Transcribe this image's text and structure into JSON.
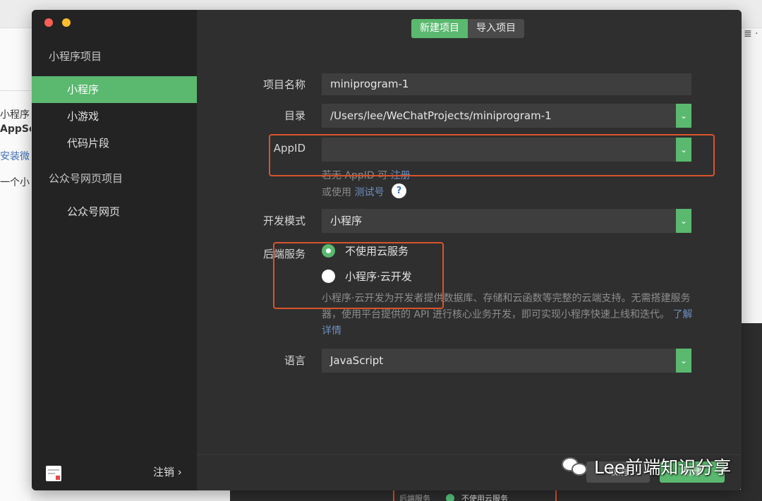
{
  "background": {
    "side_text_1": "小程序",
    "side_text_2": "AppSe",
    "side_text_3": "安装微",
    "side_text_4": "一个小",
    "bottom_text_1": "后端服务",
    "bottom_text_2": "不使用云服务"
  },
  "window": {
    "tabs": [
      {
        "label": "新建项目",
        "active": true
      },
      {
        "label": "导入项目",
        "active": false
      }
    ]
  },
  "sidebar": {
    "section_1": "小程序项目",
    "items_1": [
      "小程序",
      "小游戏",
      "代码片段"
    ],
    "section_2": "公众号网页项目",
    "items_2": [
      "公众号网页"
    ],
    "logout": "注销",
    "logout_chevron": "›"
  },
  "form": {
    "name_label": "项目名称",
    "name_value": "miniprogram-1",
    "dir_label": "目录",
    "dir_value": "/Users/lee/WeChatProjects/miniprogram-1",
    "appid_label": "AppID",
    "appid_value": "",
    "appid_hint_1": "若无 AppID 可",
    "appid_hint_register": "注册",
    "appid_hint_2": "或使用",
    "appid_hint_test": "测试号",
    "help_icon": "?",
    "mode_label": "开发模式",
    "mode_value": "小程序",
    "backend_label": "后端服务",
    "backend_option_1": "不使用云服务",
    "backend_option_2": "小程序·云开发",
    "backend_desc": "小程序·云开发为开发者提供数据库、存储和云函数等完整的云端支持。无需搭建服务器，使用平台提供的 API 进行核心业务开发，即可实现小程序快速上线和迭代。",
    "backend_learn_more": "了解详情",
    "lang_label": "语言",
    "lang_value": "JavaScript",
    "chevron": "⌄"
  },
  "footer": {
    "cancel": "取消",
    "create": "新建"
  },
  "watermark": "Lee前端知识分享",
  "colors": {
    "accent": "#5ab96f",
    "annotation": "#d8542c",
    "window_bg": "#2f2f2f",
    "sidebar_bg": "#232323"
  }
}
